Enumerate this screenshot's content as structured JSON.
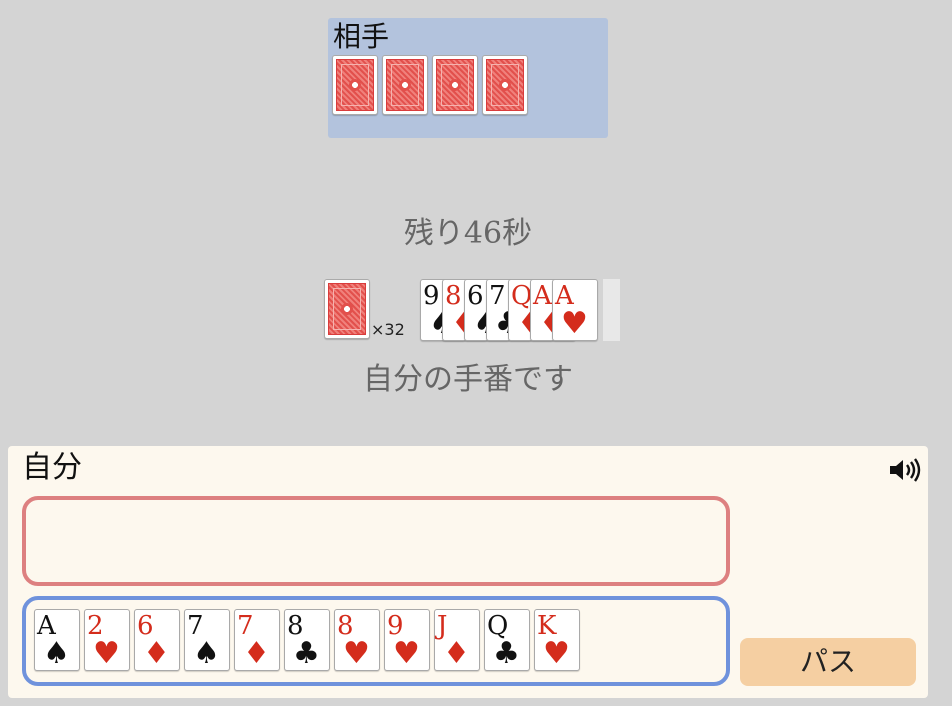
{
  "opponent": {
    "label": "相手",
    "card_count": 4
  },
  "timer_text": "残り46秒",
  "deck": {
    "count_label": "×32"
  },
  "field_cards": [
    {
      "rank": "9",
      "suit": "♠",
      "color": "black"
    },
    {
      "rank": "8",
      "suit": "♦",
      "color": "red"
    },
    {
      "rank": "6",
      "suit": "♠",
      "color": "black"
    },
    {
      "rank": "7",
      "suit": "♣",
      "color": "black"
    },
    {
      "rank": "Q",
      "suit": "♦",
      "color": "red"
    },
    {
      "rank": "A",
      "suit": "♦",
      "color": "red"
    },
    {
      "rank": "A",
      "suit": "♥",
      "color": "red"
    }
  ],
  "status_text": "自分の手番です",
  "self": {
    "label": "自分",
    "speaker_icon": "speaker-volume-icon"
  },
  "hand": [
    {
      "rank": "A",
      "suit": "♠",
      "color": "black"
    },
    {
      "rank": "2",
      "suit": "♥",
      "color": "red"
    },
    {
      "rank": "6",
      "suit": "♦",
      "color": "red"
    },
    {
      "rank": "7",
      "suit": "♠",
      "color": "black"
    },
    {
      "rank": "7",
      "suit": "♦",
      "color": "red"
    },
    {
      "rank": "8",
      "suit": "♣",
      "color": "black"
    },
    {
      "rank": "8",
      "suit": "♥",
      "color": "red"
    },
    {
      "rank": "9",
      "suit": "♥",
      "color": "red"
    },
    {
      "rank": "J",
      "suit": "♦",
      "color": "red"
    },
    {
      "rank": "Q",
      "suit": "♣",
      "color": "black"
    },
    {
      "rank": "K",
      "suit": "♥",
      "color": "red"
    }
  ],
  "pass_label": "パス",
  "colors": {
    "red_suit": "#d42c1c",
    "black_suit": "#111111",
    "opponent_panel": "#b3c3dd",
    "self_panel": "#fdf8ee",
    "play_area_border": "#dd8080",
    "hand_area_border": "#6f92dc",
    "pass_button": "#f5cfa2"
  }
}
